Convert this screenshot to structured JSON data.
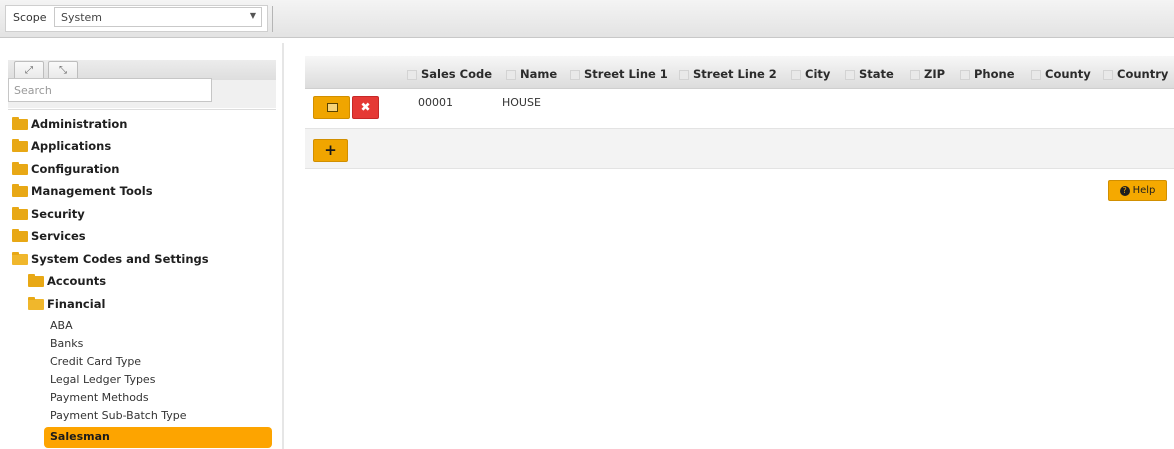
{
  "scope": {
    "label": "Scope",
    "value": "System"
  },
  "search": {
    "placeholder": "Search"
  },
  "tree": {
    "folders": [
      "Administration",
      "Applications",
      "Configuration",
      "Management Tools",
      "Security",
      "Services",
      "System Codes and Settings"
    ],
    "subfolders": [
      "Accounts",
      "Financial"
    ],
    "leaves": [
      "ABA",
      "Banks",
      "Credit Card Type",
      "Legal Ledger Types",
      "Payment Methods",
      "Payment Sub-Batch Type"
    ],
    "selected": "Salesman"
  },
  "grid": {
    "columns": [
      "Sales Code",
      "Name",
      "Street Line 1",
      "Street Line 2",
      "City",
      "State",
      "ZIP",
      "Phone",
      "County",
      "Country"
    ],
    "rows": [
      {
        "sales_code": "00001",
        "name": "HOUSE"
      }
    ]
  },
  "help": {
    "label": "Help"
  },
  "colors": {
    "accent": "#f0a500",
    "selected": "#fda400",
    "delete": "#e53935",
    "folder": "#e8a815"
  },
  "icons": [
    "expand-icon",
    "collapse-icon",
    "folder-icon",
    "edit-icon",
    "delete-icon",
    "add-icon",
    "help-icon",
    "chevron-down-icon"
  ]
}
